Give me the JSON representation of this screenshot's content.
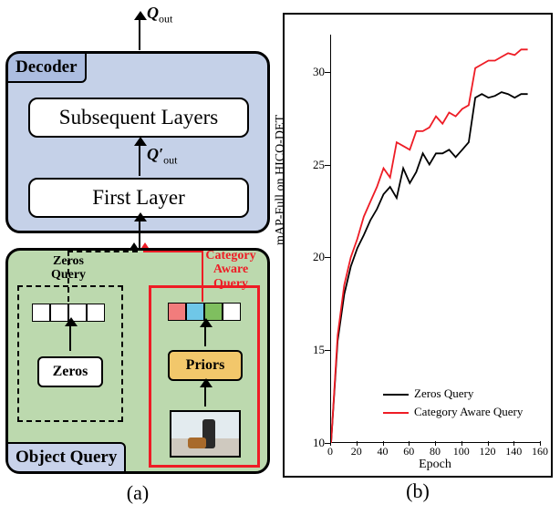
{
  "panel_a": {
    "caption": "(a)",
    "decoder": {
      "tag": "Decoder",
      "subsequent": "Subsequent Layers",
      "first": "First Layer",
      "q_out": "Q",
      "q_out_sub": "out",
      "q_prime": "Q′",
      "q_prime_sub": "out"
    },
    "object_query": {
      "tag": "Object Query",
      "zeros_title_l1": "Zeros",
      "zeros_title_l2": "Query",
      "cat_title_l1": "Category",
      "cat_title_l2": "Aware",
      "cat_title_l3": "Query",
      "zeros_slab": "Zeros",
      "priors_slab": "Priors"
    }
  },
  "panel_b": {
    "caption": "(b)",
    "xlabel": "Epoch",
    "ylabel": "mAP-Full on HICO-DET",
    "legend_zeros": "Zeros Query",
    "legend_cat": "Category Aware Query",
    "xticks": [
      "0",
      "20",
      "40",
      "60",
      "80",
      "100",
      "120",
      "140",
      "160"
    ],
    "yticks": [
      "10",
      "15",
      "20",
      "25",
      "30"
    ]
  },
  "chart_data": {
    "type": "line",
    "xlabel": "Epoch",
    "ylabel": "mAP-Full on HICO-DET",
    "xlim": [
      0,
      160
    ],
    "ylim": [
      10,
      32
    ],
    "x": [
      0,
      5,
      10,
      15,
      20,
      25,
      30,
      35,
      40,
      45,
      50,
      55,
      60,
      65,
      70,
      75,
      80,
      85,
      90,
      95,
      100,
      105,
      110,
      115,
      120,
      125,
      130,
      135,
      140,
      145,
      150
    ],
    "series": [
      {
        "name": "Zeros Query",
        "color": "#000000",
        "values": [
          10.0,
          15.5,
          18.0,
          19.5,
          20.5,
          21.2,
          22.0,
          22.6,
          23.4,
          23.8,
          23.2,
          24.8,
          24.0,
          24.6,
          25.6,
          25.0,
          25.6,
          25.6,
          25.8,
          25.4,
          25.8,
          26.2,
          28.6,
          28.8,
          28.6,
          28.7,
          28.9,
          28.8,
          28.6,
          28.8,
          28.8
        ]
      },
      {
        "name": "Category Aware Query",
        "color": "#ee1c25",
        "values": [
          10.0,
          15.8,
          18.5,
          20.0,
          21.0,
          22.2,
          23.0,
          23.8,
          24.8,
          24.3,
          26.2,
          26.0,
          25.8,
          26.8,
          26.8,
          27.0,
          27.6,
          27.2,
          27.8,
          27.6,
          28.0,
          28.2,
          30.2,
          30.4,
          30.6,
          30.6,
          30.8,
          31.0,
          30.9,
          31.2,
          31.2
        ]
      }
    ]
  }
}
